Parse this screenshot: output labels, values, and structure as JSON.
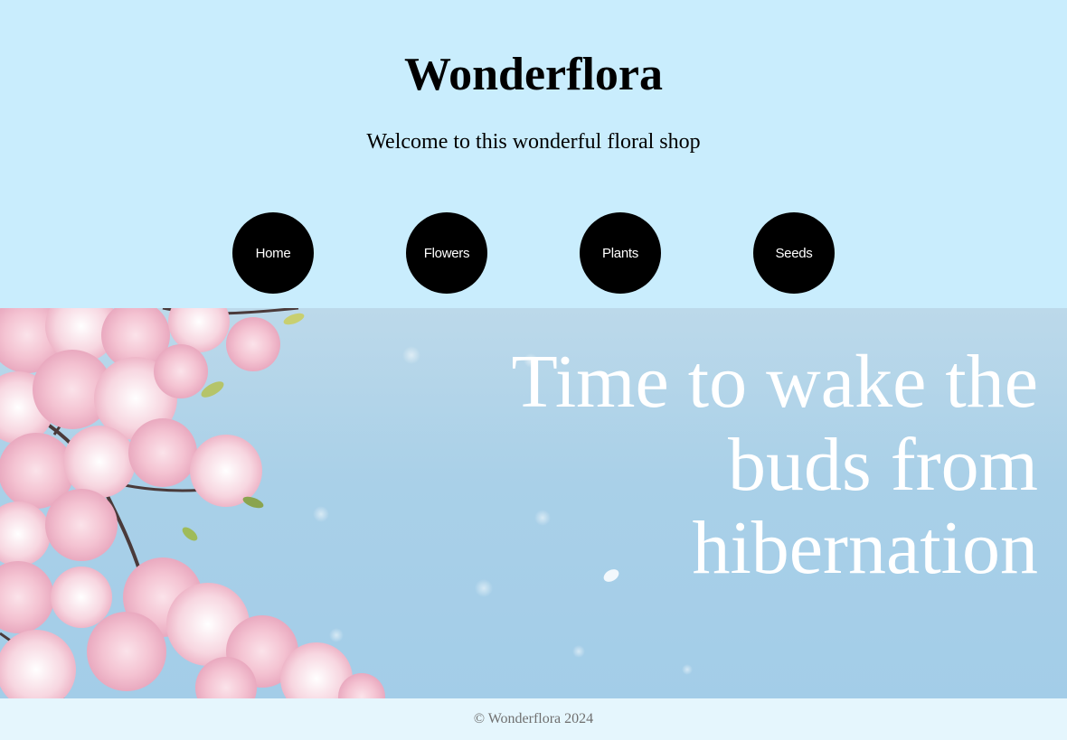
{
  "header": {
    "title": "Wonderflora",
    "tagline": "Welcome to this wonderful floral shop",
    "background_color": "#c9edfd"
  },
  "nav": {
    "items": [
      {
        "label": "Home"
      },
      {
        "label": "Flowers"
      },
      {
        "label": "Plants"
      },
      {
        "label": "Seeds"
      }
    ],
    "button_color": "#000000",
    "text_color": "#ffffff"
  },
  "hero": {
    "headline": "Time to wake the buds from hibernation",
    "image_subject": "cherry-blossom-branch",
    "sky_color": "#a9d0e8"
  },
  "footer": {
    "copyright": "© Wonderflora 2024",
    "background_color": "#e5f6fd"
  }
}
